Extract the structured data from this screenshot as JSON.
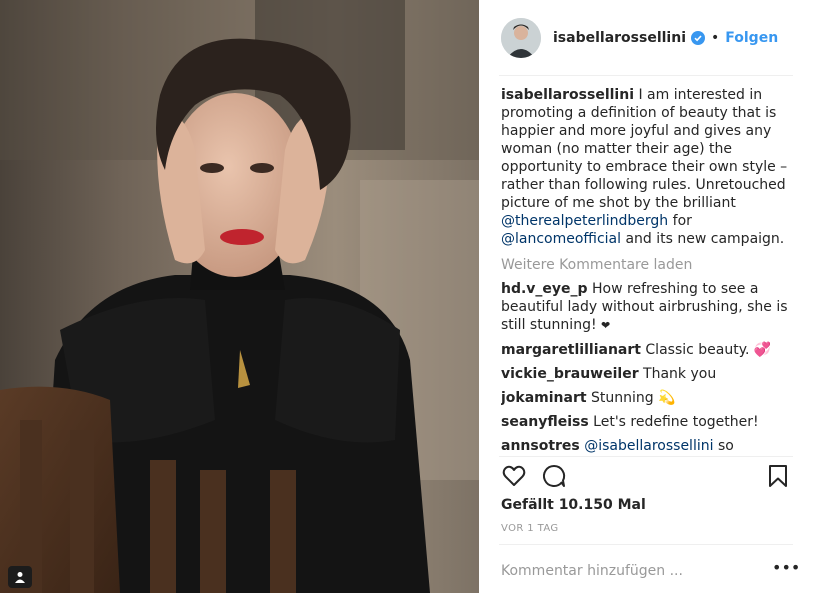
{
  "post": {
    "username": "isabellarossellini",
    "verified_icon": "verified-badge-icon",
    "separator": "•",
    "follow_label": "Folgen",
    "caption": {
      "username": "isabellarossellini",
      "text_before": "I am interested in promoting a definition of beauty that is happier and more joyful and gives any woman (no matter their age) the opportunity to embrace their own style – rather than following rules. Unretouched picture of me shot by the brilliant",
      "mention1": "@therealpeterlindbergh",
      "text_middle": "for",
      "mention2": "@lancomeofficial",
      "text_after": "and its new campaign."
    },
    "load_more": "Weitere Kommentare laden",
    "comments": [
      {
        "user": "hd.v_eye_p",
        "text": "How refreshing to see a beautiful lady without airbrushing, she is still stunning!",
        "emoji": "❤"
      },
      {
        "user": "margaretlillianart",
        "text": "Classic beauty.",
        "emoji": "💞"
      },
      {
        "user": "vickie_brauweiler",
        "text": "Thank you",
        "emoji": ""
      },
      {
        "user": "jokaminart",
        "text": "Stunning",
        "emoji": "💫"
      },
      {
        "user": "seanyfleiss",
        "text": "Let's redefine together!",
        "emoji": ""
      },
      {
        "user": "annsotres",
        "mention": "@isabellarossellini",
        "text": "so"
      }
    ],
    "likes": "Gefällt 10.150 Mal",
    "time_ago": "VOR 1 TAG",
    "add_comment_placeholder": "Kommentar hinzufügen ...",
    "more_label": "•••",
    "icons": {
      "like": "heart-outline-icon",
      "comment": "speech-bubble-icon",
      "save": "bookmark-icon",
      "tag": "person-tag-icon"
    },
    "colors": {
      "link_blue": "#3897f0",
      "mention_blue": "#003569",
      "muted": "#999999",
      "text": "#262626"
    }
  }
}
